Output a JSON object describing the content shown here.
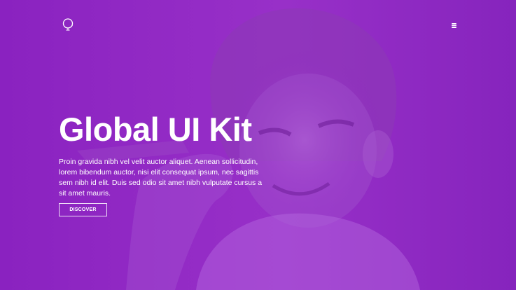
{
  "theme": {
    "overlay_color": "#8a22c0",
    "text_color": "#ffffff"
  },
  "header": {
    "logo_icon": "globe-outline-icon",
    "menu_icon": "hamburger-menu-icon"
  },
  "hero": {
    "title": "Global UI Kit",
    "description": "Proin gravida nibh vel velit auctor aliquet. Aenean sollicitudin, lorem bibendum auctor, nisi elit consequat ipsum, nec sagittis sem nibh id elit. Duis sed odio sit amet nibh vulputate cursus a sit amet mauris.",
    "cta_label": "DISCOVER"
  }
}
